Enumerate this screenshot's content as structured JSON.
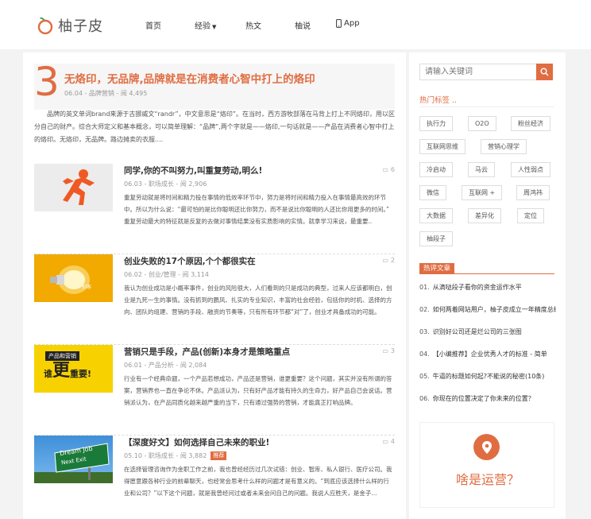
{
  "brand": {
    "logo_text": "柚子皮",
    "accent": "#e06d42"
  },
  "nav": {
    "home": "首页",
    "experience": "经验",
    "hot": "热文",
    "grapefruit": "柚说",
    "app": "App"
  },
  "featured": {
    "number": "3",
    "title": "无烙印，无品牌,品牌就是在消费者心智中打上的烙印",
    "meta": "06.04 - 品牌营销 - 阅 4,495",
    "excerpt": "品牌的英文单词brand来源于古挪威文“randr”，中文意思是“烙印”。在当时，西方游牧部落在马背上打上不同烙印，用以区分自己的财产。综合大师定义和基本概念，可以简单理解：“品牌”,两个字就是——烙印,一句话就是——产品在消费者心智中打上的烙印。无烙印，无品牌。路边摊卖的衣服...."
  },
  "posts": [
    {
      "title": "同学,你的不叫努力,叫重复劳动,明么!",
      "comments": "6",
      "meta": "06.03 - 职场成长 - 阅 2,906",
      "excerpt": "重复劳动就是将时间和精力投在事情的低效率环节中，努力是将时间和精力投入在事情最高效的环节中。所以为什么说：“最可怕的是比你聪明还比你努力，而不是说比你聪明的人还比你用更多的时间。” 重复劳动最大的特征就是反复的去做对事情结果没有实质影响的实情。就拿学习来说，最重要..",
      "badge": ""
    },
    {
      "title": "创业失败的17个原因,个个都很实在",
      "comments": "2",
      "meta": "06.02 - 创业/管理 - 阅 3,114",
      "excerpt": "我认为创业成功是小概率事件，创业的风险很大，人们看到的只是成功的典型，过来人应该都明白，创业是九死一生的事情。没有抓到的鹏风、扎实的专业知识，丰富的社会经验，包括你的时机、选择的方向、团队的组建、营销的手段、融资的节奏等，只有所有环节都“对”了，创业才具备成功的可能。",
      "badge": ""
    },
    {
      "title": "营销只是手段，产品(创新)本身才是策略重点",
      "comments": "3",
      "meta": "06.01 - 产品分析 - 阅 2,084",
      "excerpt": "行业有一个经典命题，一个产品若想成功，产品还是营销，谁更重要？这个问题，其实并没有所谓的答案，营销界也一直在争论不休。产品派认为，只有好产品才能有持久的生命力，好产品自己会说话。营销派认为，在产品同质化越来越严重的当下，只有通过强势的营销，才能真正打响品牌。",
      "badge": ""
    },
    {
      "title": "【深度好文】如何选择自己未来的职业!",
      "comments": "4",
      "meta": "05.10 - 职场成长 - 阅 3,882",
      "excerpt": "在选择管理咨询作为金职工作之前，我也曾经经历过几次试错：创业、智库、私人银行、医疗公司。我得愿意跟各种行业的前辈聊天，也经常会思考什么样的问题才是有意义的。“到底应该选择什么样的行业和公司？”以下这个问题，就是我曾经问过或者未来会问自己的问题。我说人应胜天，是金子...",
      "badge": "推荐"
    }
  ],
  "thumbs": {
    "thumb1": "",
    "thumb2_text": "创客",
    "thumb3_line1": "产品和营销",
    "thumb3_line2a": "谁",
    "thumb3_line2b": "更",
    "thumb3_line2c": "重要!",
    "thumb4_sign1": "Dream Job",
    "thumb4_sign2": "Next Exit"
  },
  "sidebar": {
    "search_placeholder": "请输入关键词",
    "tags_heading": "热门标签 ..",
    "tags": [
      "执行力",
      "O2O",
      "粉丝经济",
      "互联网思维",
      "营销心理学",
      "冷启动",
      "马云",
      "人性弱点",
      "微信",
      "互联网 +",
      "周鸿祎",
      "大数据",
      "差异化",
      "定位",
      "柚段子"
    ],
    "hot_heading": "热评文章",
    "hot": [
      {
        "n": "01.",
        "text": "从滴哒段子看你的资金运作水平"
      },
      {
        "n": "02.",
        "text": "如何两着网站用户，柚子皮成立一年精度总结"
      },
      {
        "n": "03.",
        "text": "识别好公司还是烂公司的三张图"
      },
      {
        "n": "04.",
        "text": "【小编推荐】企业优秀人才的标准 - 简单"
      },
      {
        "n": "05.",
        "text": "牛逼的标题如何起?不能说的秘密(10条)"
      },
      {
        "n": "06.",
        "text": "你现在的位置决定了你未来的位置？"
      }
    ],
    "promo_text": "啥是运营？"
  }
}
